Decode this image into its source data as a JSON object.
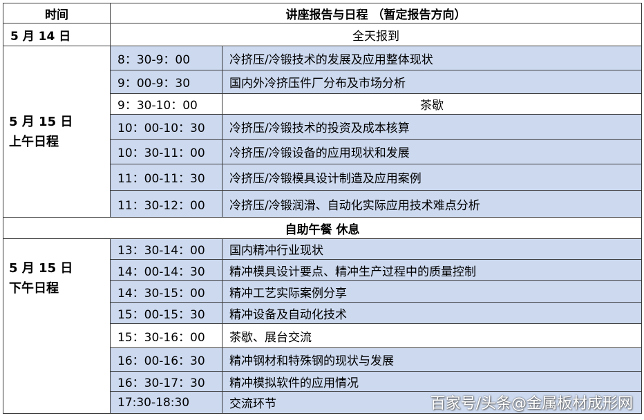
{
  "header": {
    "time": "时间",
    "agenda": "讲座报告与日程  （暂定报告方向）"
  },
  "day1": {
    "date": "5 月 14 日",
    "event": "全天报到"
  },
  "morning": {
    "date": "5 月 15 日",
    "label": "上午日程",
    "rows": [
      {
        "time": "8：30-9：00",
        "topic": "冷挤压/冷锻技术的发展及应用整体现状"
      },
      {
        "time": "9：00-9：30",
        "topic": "国内外冷挤压件厂分布及市场分析"
      },
      {
        "time": "9：30-10：00",
        "topic": "茶歇"
      },
      {
        "time": "10：00-10：30",
        "topic": "冷挤压/冷锻技术的投资及成本核算"
      },
      {
        "time": "10：30-11：00",
        "topic": "冷挤压/冷锻设备的应用现状和发展"
      },
      {
        "time": "11：00-11：30",
        "topic": "冷挤压/冷锻模具设计制造及应用案例"
      },
      {
        "time": "11：30-12：00",
        "topic": "冷挤压/冷锻润滑、自动化实际应用技术难点分析"
      }
    ]
  },
  "lunch": {
    "label": "自助午餐   休息"
  },
  "afternoon": {
    "date": "5 月 15 日",
    "label": "下午日程",
    "rows": [
      {
        "time": "13：30-14：00",
        "topic": "国内精冲行业现状"
      },
      {
        "time": "14：00-14：30",
        "topic": "精冲模具设计要点、精冲生产过程中的质量控制"
      },
      {
        "time": "14：30-15：00",
        "topic": "精冲工艺实际案例分享"
      },
      {
        "time": "15：00-15：30",
        "topic": "精冲设备及自动化技术"
      },
      {
        "time": "15：30-16：00",
        "topic": "茶歇、展台交流"
      },
      {
        "time": "16：00-16：30",
        "topic": "精冲钢材和特殊钢的现状与发展"
      },
      {
        "time": "16：30-17：30",
        "topic": "精冲模拟软件的应用情况"
      },
      {
        "time": "17:30-18:30",
        "topic": "交流环节"
      }
    ]
  },
  "watermark": "百家号/头条@金属板材成形网"
}
